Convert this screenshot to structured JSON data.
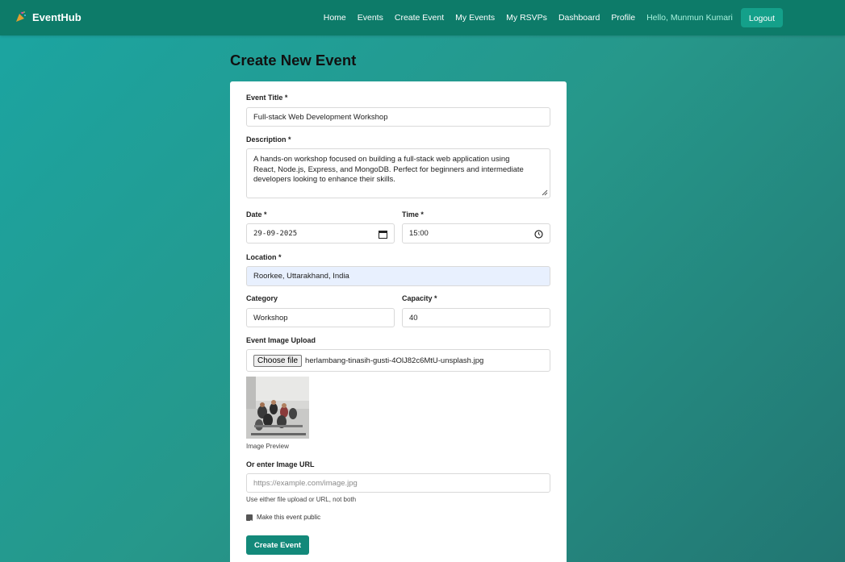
{
  "brand": {
    "name": "EventHub",
    "icon": "party-popper-icon"
  },
  "nav": {
    "links": [
      "Home",
      "Events",
      "Create Event",
      "My Events",
      "My RSVPs",
      "Dashboard",
      "Profile"
    ],
    "greeting": "Hello, Munmun Kumari",
    "logout_label": "Logout"
  },
  "page": {
    "title": "Create New Event"
  },
  "form": {
    "title_label": "Event Title *",
    "title_value": "Full-stack Web Development Workshop",
    "description_label": "Description *",
    "description_lines": [
      "A hands-on workshop focused on building a full-stack web application using",
      "React, Node.js, Express, and MongoDB. Perfect for beginners and intermediate",
      "developers looking to enhance their skills."
    ],
    "date_label": "Date *",
    "date_value": "29-09-2025",
    "time_label": "Time *",
    "time_value": "15:00",
    "location_label": "Location *",
    "location_value": "Roorkee, Uttarakhand, India",
    "category_label": "Category",
    "category_value": "Workshop",
    "capacity_label": "Capacity *",
    "capacity_value": "40",
    "image_upload_label": "Event Image Upload",
    "choose_file_label": "Choose file",
    "file_name": "herlambang-tinasih-gusti-4OlJ82c6MtU-unsplash.jpg",
    "preview_caption": "Image Preview",
    "image_url_label": "Or enter Image URL",
    "image_url_placeholder": "https://example.com/image.jpg",
    "image_url_hint": "Use either file upload or URL, not both",
    "public_label": "Make this event public",
    "public_checked": true,
    "submit_label": "Create Event"
  }
}
